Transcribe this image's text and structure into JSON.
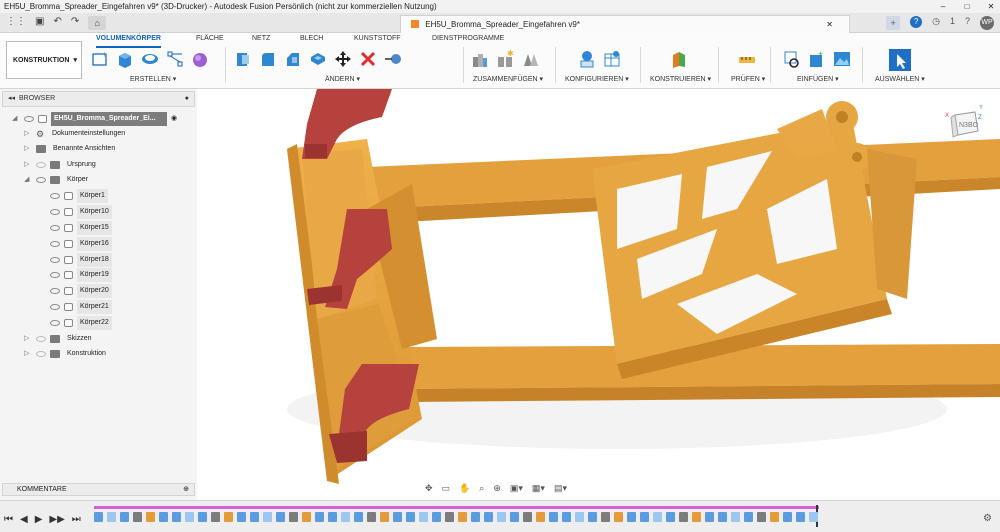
{
  "window": {
    "title": "EH5U_Bromma_Spreader_Eingefahren v9* (3D-Drucker) - Autodesk Fusion Persönlich (nicht zur kommerziellen Nutzung)",
    "controls": [
      "–",
      "□",
      "✕"
    ]
  },
  "quick_access": {
    "icons": [
      "grid-menu-icon",
      "save-icon",
      "undo-icon",
      "redo-icon",
      "home-icon"
    ],
    "undo": "↶",
    "redo": "↷",
    "save": "▣",
    "grid": "⋮⋮",
    "home": "⌂"
  },
  "document_tab": {
    "label": "EH5U_Bromma_Spreader_Eingefahren v9*",
    "close": "✕"
  },
  "top_right": {
    "plus": "+",
    "help": "?",
    "notify_count": "1",
    "avatar": "WP"
  },
  "ribbon": {
    "workspace": "KONSTRUKTION",
    "tabs": [
      "VOLUMENKÖRPER",
      "FLÄCHE",
      "NETZ",
      "BLECH",
      "KUNSTSTOFF",
      "DIENSTPROGRAMME"
    ],
    "groups": [
      "ERSTELLEN ▾",
      "ÄNDERN ▾",
      "ZUSAMMENFÜGEN ▾",
      "KONFIGURIEREN ▾",
      "KONSTRUIEREN ▾",
      "PRÜFEN ▾",
      "EINFÜGEN ▾",
      "AUSWÄHLEN ▾"
    ]
  },
  "browser": {
    "header": "BROWSER",
    "root": "EH5U_Bromma_Spreader_Ei...",
    "items": [
      "Dokumenteinstellungen",
      "Benannte Ansichten",
      "Ursprung",
      "Körper",
      "Körper1",
      "Körper10",
      "Körper15",
      "Körper16",
      "Körper18",
      "Körper19",
      "Körper20",
      "Körper21",
      "Körper22",
      "Skizzen",
      "Konstruktion"
    ]
  },
  "comments": {
    "label": "KOMMENTARE"
  },
  "viewcube": {
    "face": "N3BO",
    "axis_x": "X",
    "axis_y": "Y",
    "axis_z": "Z"
  },
  "colors": {
    "accent": "#0f63b8",
    "part_orange": "#e8a33c",
    "part_red": "#b2413c",
    "timeline_track": "#d760d6"
  }
}
